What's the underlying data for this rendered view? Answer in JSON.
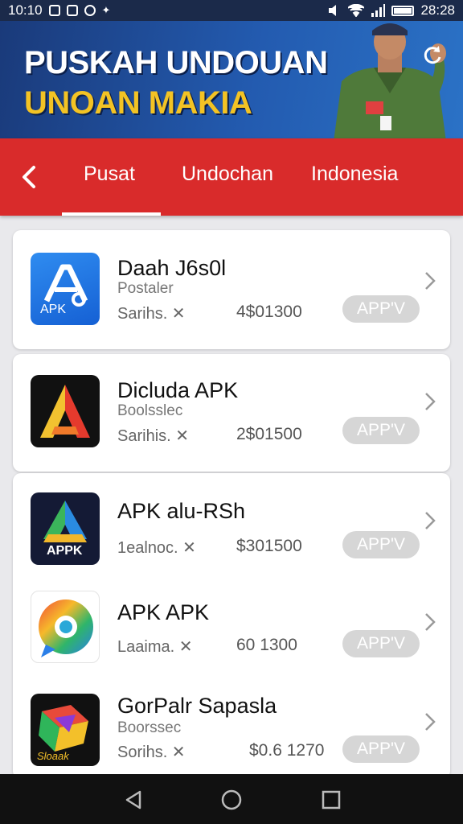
{
  "status_bar": {
    "time_left": "10:10",
    "time_right": "28:28"
  },
  "banner": {
    "title_line1": "PUSKAH UNDOUAN",
    "title_line2": "UNOAN MAKIA",
    "colors": {
      "title1": "#ffffff",
      "title2": "#f3c324"
    }
  },
  "tabs": {
    "items": [
      "Pusat",
      "Undochan",
      "Indonesia"
    ],
    "active": "Pusat"
  },
  "apps": [
    {
      "name": "Daah J6s0l",
      "developer": "Postaler",
      "meta": "Sarihs. ✕",
      "size": "4$01300",
      "button": "APP'V",
      "icon": "blue-apk-icon",
      "icon_label": "APK"
    },
    {
      "name": "Dicluda APK",
      "developer": "Boolsslec",
      "meta": "Sarihis. ✕",
      "size": "2$01500",
      "button": "APP'V",
      "icon": "triangle-apk-icon"
    },
    {
      "name": "APK alu-RSh",
      "developer": "",
      "meta": "1ealnoc. ✕ ",
      "size": "$301500",
      "button": "APP'V",
      "icon": "prism-apk-icon",
      "icon_label": "APPK"
    },
    {
      "name": "APK APK",
      "developer": "",
      "meta": "Laaima. ✕",
      "size": "60 1300",
      "button": "APP'V",
      "icon": "chat-bubble-icon"
    },
    {
      "name": "GorPalr Sapasla",
      "developer": "Boorssec",
      "meta": "Sorihs. ✕ ",
      "size": "$0.6 1270",
      "button": "APP'V",
      "icon": "cube-icon",
      "icon_label": "Sloaak"
    }
  ],
  "colors": {
    "tabbar": "#d92b2b",
    "banner": "#235bb0",
    "button_bg": "#d6d6d6"
  },
  "navbar": {
    "items": [
      "back-icon",
      "home-icon",
      "recents-icon"
    ]
  }
}
